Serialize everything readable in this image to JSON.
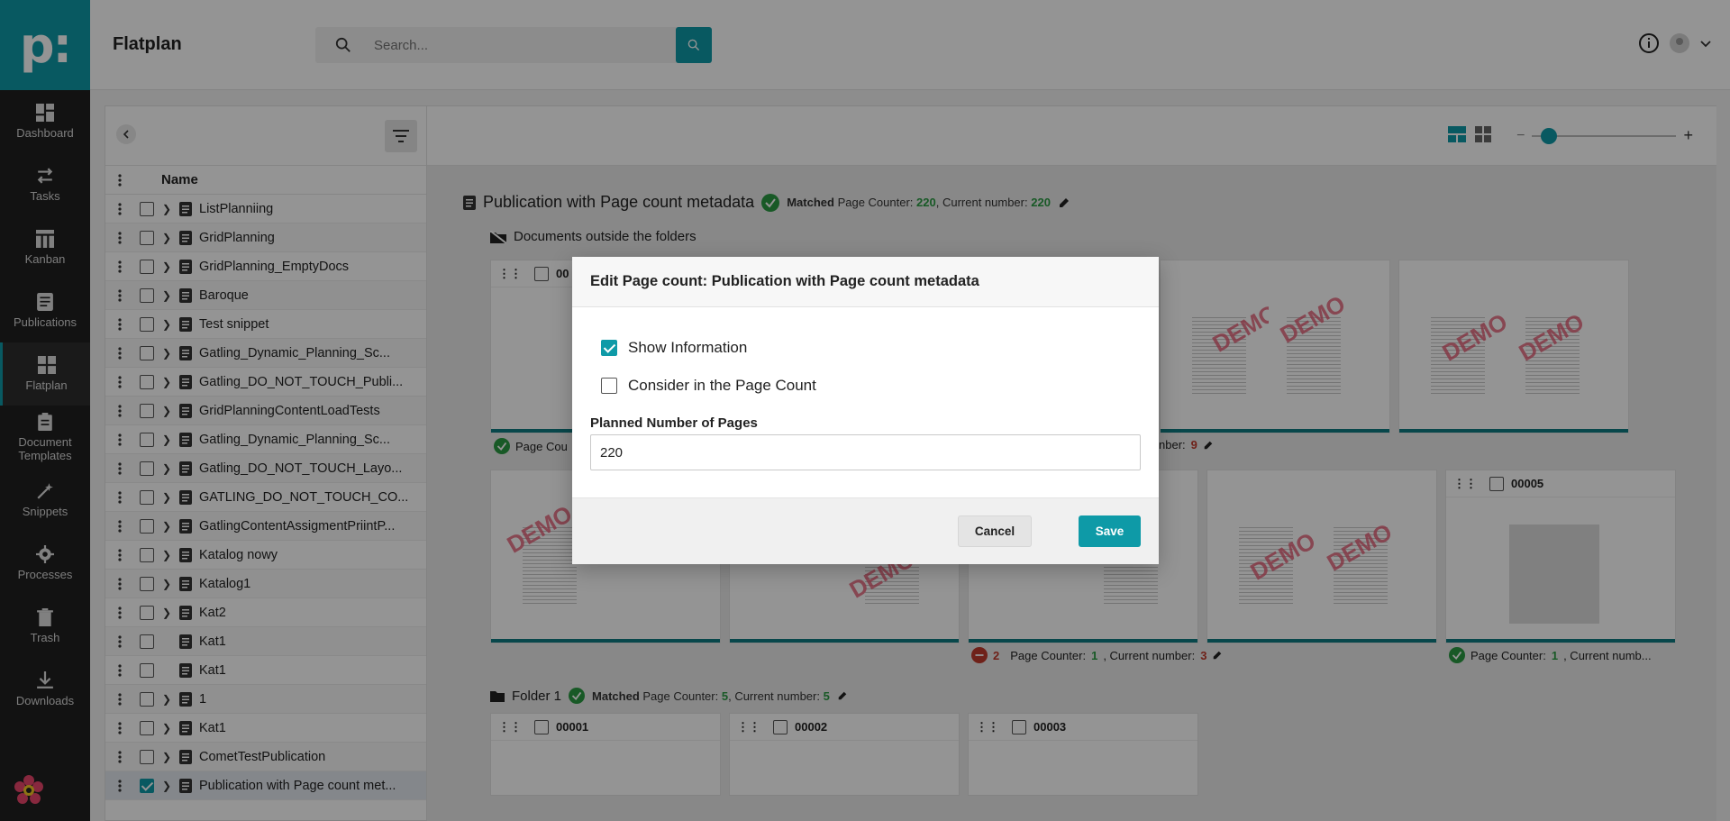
{
  "brand": {
    "logo_text": "p:",
    "accent": "#0e9aa7"
  },
  "nav": {
    "items": [
      {
        "label": "Dashboard",
        "icon": "dashboard-icon"
      },
      {
        "label": "Tasks",
        "icon": "tasks-icon"
      },
      {
        "label": "Kanban",
        "icon": "kanban-icon"
      },
      {
        "label": "Publications",
        "icon": "publications-icon"
      },
      {
        "label": "Flatplan",
        "icon": "flatplan-icon",
        "active": true
      },
      {
        "label": "Document Templates",
        "icon": "document-templates-icon"
      },
      {
        "label": "Snippets",
        "icon": "snippets-icon"
      },
      {
        "label": "Processes",
        "icon": "gear-icon"
      },
      {
        "label": "Trash",
        "icon": "trash-icon"
      },
      {
        "label": "Downloads",
        "icon": "download-icon"
      }
    ]
  },
  "header": {
    "title": "Flatplan",
    "search_placeholder": "Search..."
  },
  "tree": {
    "column_name": "Name",
    "rows": [
      {
        "label": "ListPlanniing",
        "expandable": true
      },
      {
        "label": "GridPlanning",
        "expandable": true
      },
      {
        "label": "GridPlanning_EmptyDocs",
        "expandable": true
      },
      {
        "label": "Baroque",
        "expandable": true
      },
      {
        "label": "Test snippet",
        "expandable": true
      },
      {
        "label": "Gatling_Dynamic_Planning_Sc...",
        "expandable": true
      },
      {
        "label": "Gatling_DO_NOT_TOUCH_Publi...",
        "expandable": true
      },
      {
        "label": "GridPlanningContentLoadTests",
        "expandable": true
      },
      {
        "label": "Gatling_Dynamic_Planning_Sc...",
        "expandable": true
      },
      {
        "label": "Gatling_DO_NOT_TOUCH_Layo...",
        "expandable": true
      },
      {
        "label": "GATLING_DO_NOT_TOUCH_CO...",
        "expandable": true
      },
      {
        "label": "GatlingContentAssigmentPriintP...",
        "expandable": true
      },
      {
        "label": "Katalog nowy",
        "expandable": true
      },
      {
        "label": "Katalog1",
        "expandable": true
      },
      {
        "label": "Kat2",
        "expandable": true
      },
      {
        "label": "Kat1",
        "expandable": false
      },
      {
        "label": "Kat1",
        "expandable": false
      },
      {
        "label": "1",
        "expandable": true
      },
      {
        "label": "Kat1",
        "expandable": true
      },
      {
        "label": "CometTestPublication",
        "expandable": true
      },
      {
        "label": "Publication with Page count met...",
        "expandable": true,
        "checked": true
      }
    ]
  },
  "main": {
    "publication": {
      "title": "Publication with Page count metadata",
      "matched": "Matched",
      "page_counter_label": "Page Counter:",
      "page_counter": "220",
      "current_label": ", Current number:",
      "current": "220"
    },
    "outside_label": "Documents outside the folders",
    "partial_status_left": "Page Cou",
    "partial_status_mid_label": "nber:",
    "partial_status_mid_value": "9",
    "card_00005": "00005",
    "status_bad": {
      "count": "2",
      "label": "Page Counter:",
      "value": "1",
      "current_label": ", Current number:",
      "current": "3"
    },
    "status_good_partial": {
      "label": "Page Counter:",
      "value": "1",
      "current_label": ", Current numb..."
    },
    "folder1": {
      "title": "Folder 1",
      "matched": "Matched",
      "page_counter_label": "Page Counter:",
      "page_counter": "5",
      "current_label": ", Current number:",
      "current": "5"
    },
    "folder_cards": [
      "00001",
      "00002",
      "00003"
    ],
    "partial_doc_id": "00"
  },
  "dialog": {
    "title": "Edit Page count: Publication with Page count metadata",
    "show_information": {
      "label": "Show Information",
      "checked": true
    },
    "consider": {
      "label": "Consider in the Page Count",
      "checked": false
    },
    "planned_label": "Planned Number of Pages",
    "planned_value": "220",
    "cancel": "Cancel",
    "save": "Save"
  }
}
